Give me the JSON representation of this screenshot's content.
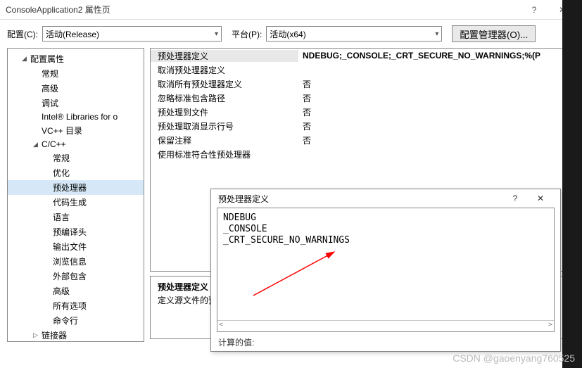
{
  "title": "ConsoleApplication2 属性页",
  "titlebar": {
    "help": "?",
    "close": "✕"
  },
  "config": {
    "label": "配置(C):",
    "value": "活动(Release)",
    "platform_label": "平台(P):",
    "platform_value": "活动(x64)",
    "manager_btn": "配置管理器(O)..."
  },
  "tree": [
    {
      "label": "配置属性",
      "level": 1,
      "caret": "◢"
    },
    {
      "label": "常规",
      "level": 2
    },
    {
      "label": "高级",
      "level": 2
    },
    {
      "label": "调试",
      "level": 2
    },
    {
      "label": "Intel® Libraries for o",
      "level": 2
    },
    {
      "label": "VC++ 目录",
      "level": 2
    },
    {
      "label": "C/C++",
      "level": 2,
      "caret": "◢"
    },
    {
      "label": "常规",
      "level": 3
    },
    {
      "label": "优化",
      "level": 3
    },
    {
      "label": "预处理器",
      "level": 3,
      "selected": true
    },
    {
      "label": "代码生成",
      "level": 3
    },
    {
      "label": "语言",
      "level": 3
    },
    {
      "label": "预编译头",
      "level": 3
    },
    {
      "label": "输出文件",
      "level": 3
    },
    {
      "label": "浏览信息",
      "level": 3
    },
    {
      "label": "外部包含",
      "level": 3
    },
    {
      "label": "高级",
      "level": 3
    },
    {
      "label": "所有选项",
      "level": 3
    },
    {
      "label": "命令行",
      "level": 3
    },
    {
      "label": "链接器",
      "level": 2,
      "caret": "▷"
    }
  ],
  "props": [
    {
      "key": "预处理器定义",
      "val": "NDEBUG;_CONSOLE;_CRT_SECURE_NO_WARNINGS;%(P",
      "bold": true,
      "hi": true
    },
    {
      "key": "取消预处理器定义",
      "val": ""
    },
    {
      "key": "取消所有预处理器定义",
      "val": "否"
    },
    {
      "key": "忽略标准包含路径",
      "val": "否"
    },
    {
      "key": "预处理到文件",
      "val": "否"
    },
    {
      "key": "预处理取消显示行号",
      "val": "否"
    },
    {
      "key": "保留注释",
      "val": "否"
    },
    {
      "key": "使用标准符合性预处理器",
      "val": ""
    }
  ],
  "desc": {
    "title": "预处理器定义",
    "text": "定义源文件的预处"
  },
  "popup": {
    "title": "预处理器定义",
    "help": "?",
    "close": "✕",
    "lines": [
      "NDEBUG",
      "_CONSOLE",
      "_CRT_SECURE_NO_WARNINGS"
    ],
    "scroll_left": "<",
    "scroll_right": ">",
    "footer": "计算的值:"
  },
  "watermark": "CSDN @gaoenyang760525"
}
